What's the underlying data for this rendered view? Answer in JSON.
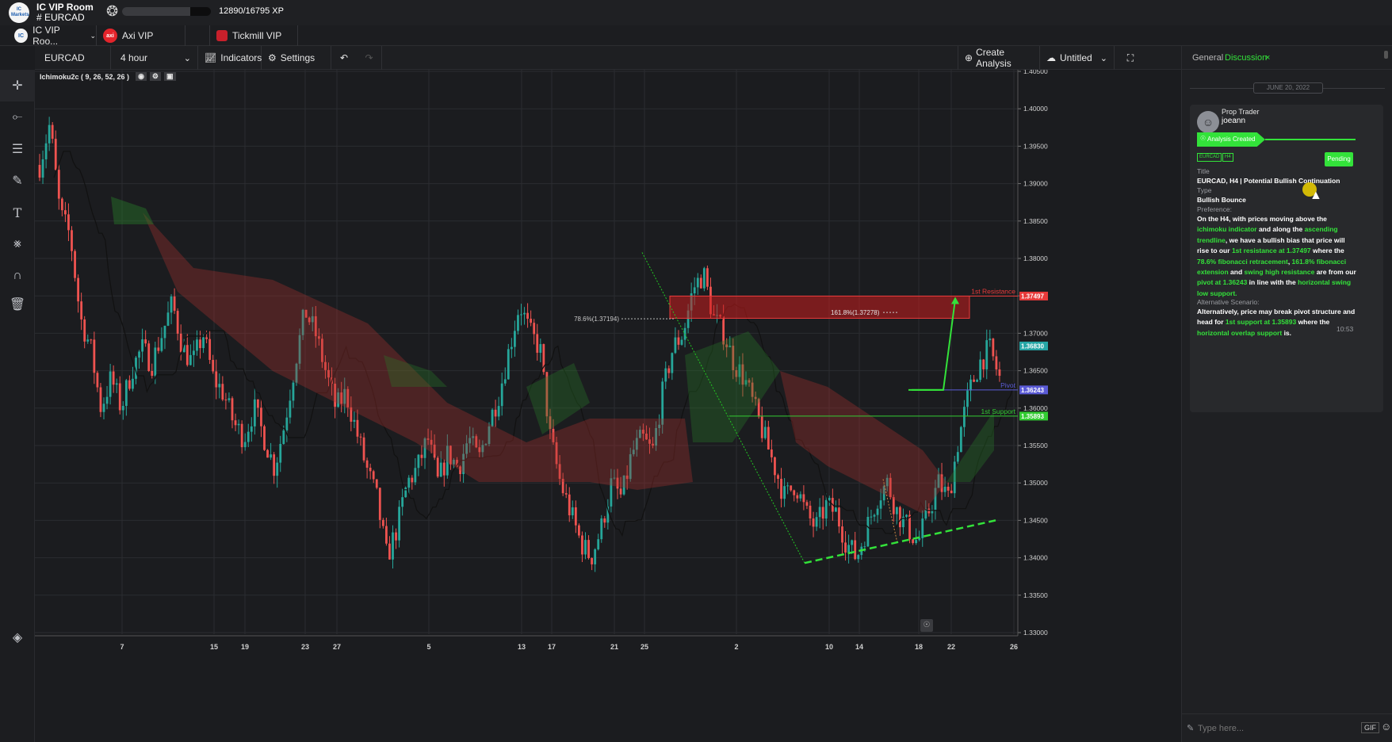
{
  "header": {
    "logo_text": "IC Markets",
    "room_title": "IC VIP Room",
    "room_channel": "# EURCAD",
    "xp_text": "12890/16795 XP",
    "xp_progress": 0.7675
  },
  "broker_tabs": [
    {
      "label": "IC VIP Roo...",
      "icon": "ic-logo-icon"
    },
    {
      "label": "Axi VIP",
      "icon": "axi-logo-icon",
      "icon_text": "axi"
    },
    {
      "label": "Tickmill VIP",
      "icon": "tickmill-logo-icon"
    }
  ],
  "toolbar": {
    "symbol": "EURCAD",
    "timeframe": "4 hour",
    "indicators_label": "Indicators",
    "settings_label": "Settings",
    "create_analysis_label": "Create Analysis",
    "layout_name": "Untitled"
  },
  "indicator_legend": "Ichimoku2c ( 9, 26, 52, 26 )",
  "chart_data": {
    "type": "candlestick",
    "symbol": "EURCAD",
    "timeframe": "4 hour",
    "ylim": [
      1.33,
      1.405
    ],
    "price_ticks": [
      "1.40500",
      "1.40000",
      "1.39500",
      "1.39000",
      "1.38500",
      "1.38000",
      "1.37500",
      "1.37000",
      "1.36500",
      "1.36000",
      "1.35500",
      "1.35000",
      "1.34500",
      "1.34000",
      "1.33500",
      "1.33000"
    ],
    "x_ticks": [
      "7",
      "15",
      "19",
      "23",
      "27",
      "5",
      "13",
      "17",
      "21",
      "25",
      "2",
      "10",
      "14",
      "18",
      "22",
      "26"
    ],
    "close_path": [
      1.3925,
      1.398,
      1.386,
      1.383,
      1.372,
      1.368,
      1.36,
      1.364,
      1.36,
      1.365,
      1.368,
      1.366,
      1.37,
      1.374,
      1.368,
      1.366,
      1.37,
      1.364,
      1.362,
      1.358,
      1.356,
      1.36,
      1.356,
      1.352,
      1.358,
      1.366,
      1.373,
      1.37,
      1.365,
      1.36,
      1.362,
      1.357,
      1.352,
      1.348,
      1.34,
      1.344,
      1.35,
      1.352,
      1.356,
      1.35,
      1.354,
      1.352,
      1.356,
      1.353,
      1.358,
      1.362,
      1.368,
      1.374,
      1.37,
      1.368,
      1.356,
      1.35,
      1.346,
      1.342,
      1.34,
      1.344,
      1.35,
      1.348,
      1.354,
      1.356,
      1.354,
      1.362,
      1.368,
      1.37,
      1.376,
      1.378,
      1.372,
      1.37,
      1.366,
      1.364,
      1.36,
      1.356,
      1.352,
      1.348,
      1.35,
      1.346,
      1.344,
      1.347,
      1.346,
      1.342,
      1.34,
      1.344,
      1.348,
      1.35,
      1.346,
      1.344,
      1.342,
      1.346,
      1.35,
      1.348,
      1.356,
      1.362,
      1.366,
      1.368,
      1.364
    ],
    "levels": [
      {
        "label": "1st Resistance",
        "price": 1.37497,
        "price_label": "1.37497",
        "color": "#e83a3a"
      },
      {
        "label": "Pivot",
        "price": 1.36243,
        "price_label": "1.36243",
        "color": "#5b5bd6"
      },
      {
        "label": "1st Support",
        "price": 1.35893,
        "price_label": "1.35893",
        "color": "#33cc33"
      }
    ],
    "current_price_label": "1.36830",
    "current_price": 1.3683,
    "annotations": [
      {
        "text": "78.6%(1.37194)"
      },
      {
        "text": "161.8%(1.37278)"
      }
    ]
  },
  "side_panel": {
    "tabs": [
      "General",
      "Discussion"
    ],
    "active_tab": "Discussion",
    "date_separator": "JUNE 20, 2022",
    "post": {
      "role": "Prop Trader",
      "author": "joeann",
      "status_bar": "Analysis Created",
      "tags": [
        "EURCAD",
        "H4"
      ],
      "status_badge": "Pending",
      "title_label": "Title",
      "title": "EURCAD, H4 | Potential Bullish Continuation",
      "type_label": "Type",
      "type": "Bullish Bounce",
      "preference_label": "Preference:",
      "preference_text": [
        {
          "t": "On the H4, with prices moving above the ",
          "g": false
        },
        {
          "t": "ichimoku indicator",
          "g": true
        },
        {
          "t": " and along the ",
          "g": false
        },
        {
          "t": "ascending trendline",
          "g": true
        },
        {
          "t": ", we have a bullish bias that price will rise to our ",
          "g": false
        },
        {
          "t": "1st resistance at 1.37497",
          "g": true
        },
        {
          "t": " where the ",
          "g": false
        },
        {
          "t": "78.6% fibonacci retracement",
          "g": true
        },
        {
          "t": ", ",
          "g": false
        },
        {
          "t": "161.8% fibonacci extension",
          "g": true
        },
        {
          "t": " and ",
          "g": false
        },
        {
          "t": "swing high resistance",
          "g": true
        },
        {
          "t": " are from our ",
          "g": false
        },
        {
          "t": "pivot at 1.36243",
          "g": true
        },
        {
          "t": " in line with the ",
          "g": false
        },
        {
          "t": "horizontal swing low support.",
          "g": true
        }
      ],
      "alt_label": "Alternative Scenario:",
      "alt_text": [
        {
          "t": "Alternatively, price may break pivot structure and head for ",
          "g": false
        },
        {
          "t": "1st support at 1.35893",
          "g": true
        },
        {
          "t": " where the ",
          "g": false
        },
        {
          "t": "horizontal overlap support",
          "g": true
        },
        {
          "t": " is.",
          "g": false
        }
      ],
      "time": "10:53"
    },
    "input_placeholder": "Type here...",
    "gif_label": "GIF"
  }
}
